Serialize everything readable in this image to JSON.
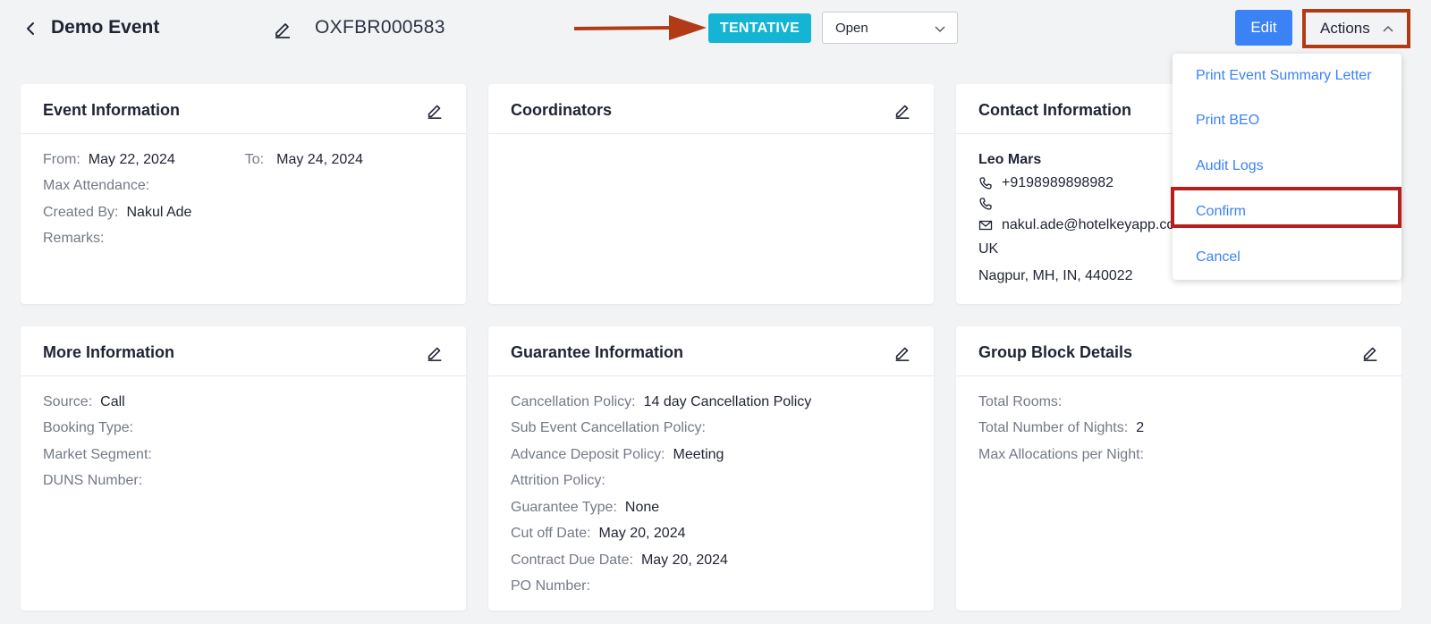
{
  "header": {
    "event_title": "Demo Event",
    "event_code": "OXFBR000583",
    "status_badge": "TENTATIVE",
    "status_select": "Open",
    "edit_label": "Edit",
    "actions_label": "Actions"
  },
  "actions_menu": [
    "Print Event Summary Letter",
    "Print BEO",
    "Audit Logs",
    "Confirm",
    "Cancel"
  ],
  "event_info": {
    "title": "Event Information",
    "from_label": "From:",
    "from_value": "May 22, 2024",
    "to_label": "To:",
    "to_value": "May 24, 2024",
    "max_attendance_label": "Max Attendance:",
    "created_by_label": "Created By:",
    "created_by_value": "Nakul Ade",
    "remarks_label": "Remarks:"
  },
  "coordinators": {
    "title": "Coordinators"
  },
  "contact_info": {
    "title": "Contact Information",
    "name": "Leo Mars",
    "phone": "+9198989898982",
    "email": "nakul.ade@hotelkeyapp.co",
    "country": "UK",
    "address": "Nagpur, MH, IN, 440022"
  },
  "more_info": {
    "title": "More Information",
    "source_label": "Source:",
    "source_value": "Call",
    "booking_type_label": "Booking Type:",
    "market_segment_label": "Market Segment:",
    "duns_label": "DUNS Number:"
  },
  "guarantee_info": {
    "title": "Guarantee Information",
    "cancellation_label": "Cancellation Policy:",
    "cancellation_value": "14 day Cancellation Policy",
    "sub_event_label": "Sub Event Cancellation Policy:",
    "advance_deposit_label": "Advance Deposit Policy:",
    "advance_deposit_value": "Meeting",
    "attrition_label": "Attrition Policy:",
    "guarantee_type_label": "Guarantee Type:",
    "guarantee_type_value": "None",
    "cut_off_label": "Cut off Date:",
    "cut_off_value": "May 20, 2024",
    "contract_due_label": "Contract Due Date:",
    "contract_due_value": "May 20, 2024",
    "po_label": "PO Number:"
  },
  "group_block": {
    "title": "Group Block Details",
    "total_rooms_label": "Total Rooms:",
    "total_nights_label": "Total Number of Nights:",
    "total_nights_value": "2",
    "max_alloc_label": "Max Allocations per Night:"
  },
  "colors": {
    "accent": "#3b82f6",
    "badge": "#13b4d4",
    "highlight_actions": "#b23a14",
    "highlight_confirm": "#b61d1d",
    "arrow": "#b23a14"
  }
}
